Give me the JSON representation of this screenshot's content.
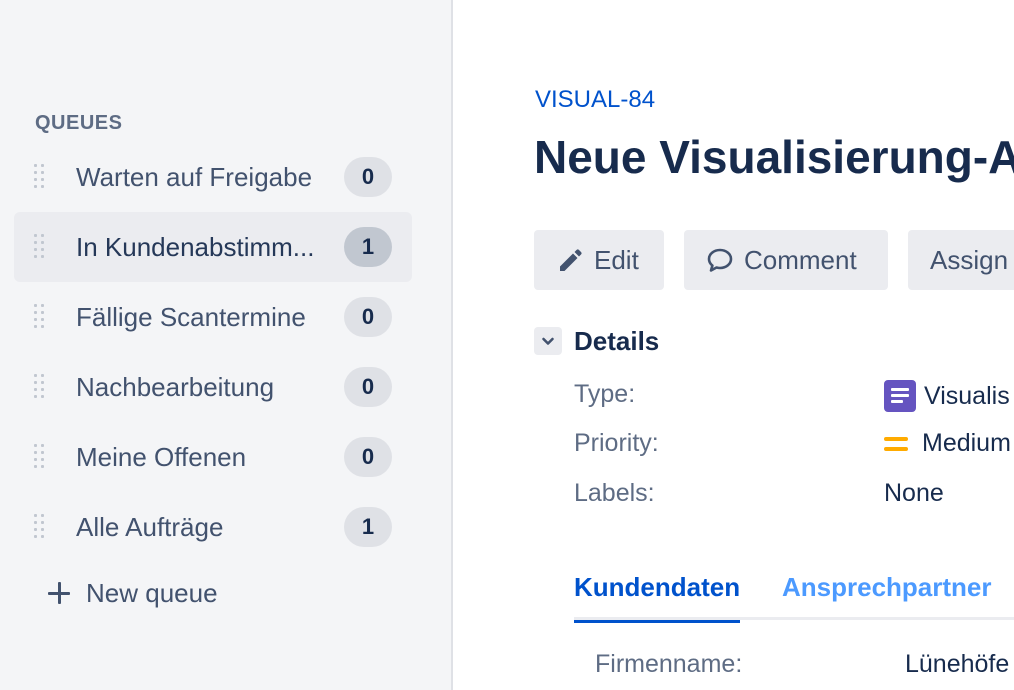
{
  "sidebar": {
    "heading": "QUEUES",
    "queues": [
      {
        "label": "Warten auf Freigabe",
        "count": "0",
        "selected": false
      },
      {
        "label": "In Kundenabstimm...",
        "count": "1",
        "selected": true
      },
      {
        "label": "Fällige Scantermine",
        "count": "0",
        "selected": false
      },
      {
        "label": "Nachbearbeitung",
        "count": "0",
        "selected": false
      },
      {
        "label": "Meine Offenen",
        "count": "0",
        "selected": false
      },
      {
        "label": "Alle Aufträge",
        "count": "1",
        "selected": false
      }
    ],
    "new_queue_label": "New queue"
  },
  "issue": {
    "key": "VISUAL-84",
    "title": "Neue Visualisierung-A",
    "actions": {
      "edit": "Edit",
      "comment": "Comment",
      "assign": "Assign"
    },
    "details": {
      "heading": "Details",
      "fields": {
        "type": {
          "label": "Type:",
          "value": "Visualis"
        },
        "priority": {
          "label": "Priority:",
          "value": "Medium"
        },
        "labels": {
          "label": "Labels:",
          "value": "None"
        }
      }
    },
    "tabs": [
      {
        "label": "Kundendaten",
        "active": true
      },
      {
        "label": "Ansprechpartner",
        "active": false
      }
    ],
    "customer": {
      "company_label": "Firmenname:",
      "company_value": "Lünehöfe"
    }
  },
  "colors": {
    "link_blue": "#0052CC",
    "tab_inactive": "#4C9AFF",
    "type_icon": "#6554C0",
    "priority_medium": "#FFAB00"
  },
  "icons": {
    "edit": "pencil-icon",
    "comment": "speech-bubble-icon",
    "details_toggle": "chevron-down-icon",
    "type": "visualisation-type-icon",
    "priority": "priority-medium-icon",
    "new_queue": "plus-icon",
    "queue_handle": "drag-handle-icon"
  }
}
